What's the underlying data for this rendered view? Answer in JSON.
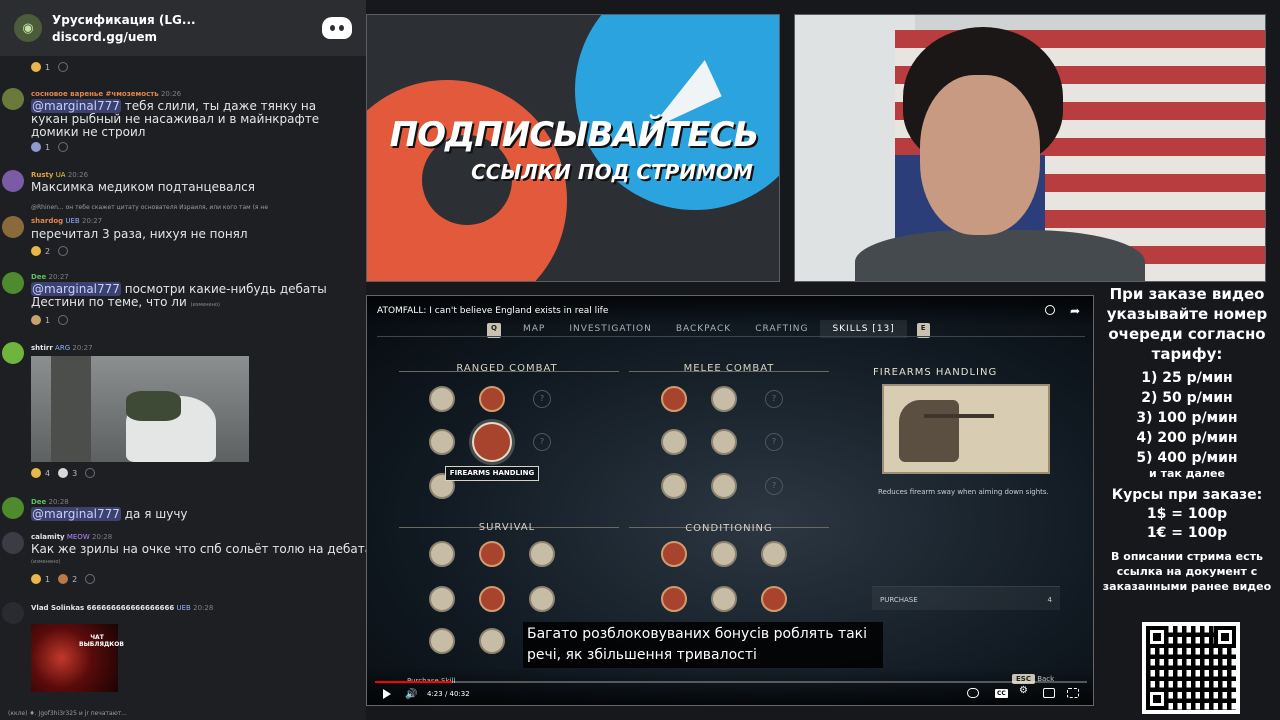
{
  "discord": {
    "server_name": "Урусификация (LG...",
    "server_link": "discord.gg/uem",
    "messages": [
      {
        "reactions": [
          {
            "count": "1"
          }
        ]
      },
      {
        "author": "сосновое варенье #чмоземость",
        "time": "20:26",
        "mention": "@marginal777",
        "text": " тебя слили, ты даже тянку на кукан рыбный не насаживал и в майнкрафте домики не строил",
        "reactions": [
          {
            "count": "1"
          }
        ]
      },
      {
        "author": "Rusty",
        "badge": "UA",
        "time": "20:26",
        "text": "Максимка медиком подтанцевался"
      },
      {
        "reply": "@Rhinen... он тебе скажет цитату основателя Израиля, или кого там (я не",
        "author": "shardog",
        "badge": "UEB",
        "time": "20:27",
        "text": "перечитал 3 раза, нихуя не понял",
        "reactions": [
          {
            "count": "2"
          }
        ]
      },
      {
        "author": "Dee",
        "time": "20:27",
        "mention": "@marginal777",
        "text": " посмотри какие-нибудь дебаты Дестини по теме, что ли",
        "edited": "(изменено)",
        "reactions": [
          {
            "count": "1"
          }
        ]
      },
      {
        "author": "shtirr",
        "badge": "ARG",
        "time": "20:27",
        "reactions": [
          {
            "count": "4"
          },
          {
            "count": "3"
          }
        ]
      },
      {
        "author": "Dee",
        "time": "20:28",
        "mention": "@marginal777",
        "text": " да я шучу"
      },
      {
        "author": "calamity",
        "badge": "MEOW",
        "time": "20:28",
        "text": "Как же зрилы на очке что спб сольёт толю на дебатах",
        "edited": "(изменено)",
        "reactions": [
          {
            "count": "1"
          },
          {
            "count": "2"
          }
        ]
      },
      {
        "author": "Vlad Solinkas 666666666666666666",
        "badge": "UEB",
        "time": "20:28",
        "image_text": "ЧАТ ВЫБЛЯДКОВ"
      }
    ],
    "typing": "(ккле) ♦. Jgof3hi3r325 и jr печатают..."
  },
  "banner": {
    "title": "ПОДПИСЫВАЙТЕСЬ",
    "subtitle": "ССЫЛКИ ПОД СТРИМОМ"
  },
  "player": {
    "video_title": "ATOMFALL: I can't believe England exists in real life",
    "key_left": "Q",
    "key_right": "E",
    "tabs": [
      "MAP",
      "INVESTIGATION",
      "BACKPACK",
      "CRAFTING",
      "SKILLS [13]"
    ],
    "active_tab": "SKILLS [13]",
    "sections": {
      "ranged": "RANGED COMBAT",
      "melee": "MELEE COMBAT",
      "survival": "SURVIVAL",
      "conditioning": "CONDITIONING"
    },
    "selected_skill_label": "FIREARMS HANDLING",
    "detail_title": "FIREARMS HANDLING",
    "detail_desc": "Reduces firearm sway when aiming down sights.",
    "purchase_label": "PURCHASE",
    "purchase_cost": "4",
    "purchase_hint": "Purchase Skill",
    "esc_label": "ESC",
    "back_label": "Back",
    "subtitle": "Багато розблоковуваних бонусів роблять такі речі, як збільшення тривалості",
    "time": "4:23 / 40:32",
    "progress": 0.108,
    "cc_label": "CC"
  },
  "info": {
    "heading": "При заказе видео указывайте номер очереди согласно тарифу:",
    "prices": [
      "1) 25 р/мин",
      "2) 50 р/мин",
      "3) 100 р/мин",
      "4) 200 р/мин",
      "5) 400 р/мин"
    ],
    "prices_more": "и так далее",
    "course_heading": "Курсы при заказе:",
    "courses": [
      "1$ = 100р",
      "1€ = 100р"
    ],
    "description": "В описании стрима есть ссылка на документ с заказанными ранее видео"
  },
  "colors": {
    "discord_bg": "#1e1f22",
    "mention_bg": "#3c4270",
    "patreon": "#e25a3b",
    "telegram": "#2aa3df",
    "yt_red": "#ff0000"
  }
}
